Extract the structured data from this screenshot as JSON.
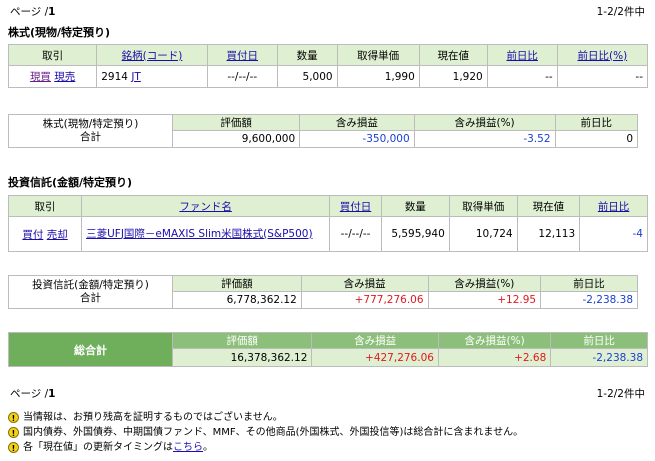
{
  "pager_top": {
    "label": "ページ /",
    "page": "1",
    "count": "1-2/2件中"
  },
  "stocks": {
    "title": "株式(現物/特定預り)",
    "headers": [
      "取引",
      "銘柄(コード)",
      "買付日",
      "数量",
      "取得単価",
      "現在値",
      "前日比",
      "前日比(%)"
    ],
    "row": {
      "buy": "現買",
      "sell": "現売",
      "code": "2914",
      "name": "JT",
      "date": "--/--/--",
      "qty": "5,000",
      "cost": "1,990",
      "price": "1,920",
      "chg": "--",
      "chg_pct": "--"
    }
  },
  "stocks_summary": {
    "label1": "株式(現物/特定預り)",
    "label2": "合計",
    "headers": [
      "評価額",
      "含み損益",
      "含み損益(%)",
      "前日比"
    ],
    "values": [
      "9,600,000",
      "-350,000",
      "-3.52",
      "0"
    ]
  },
  "funds": {
    "title": "投資信託(金額/特定預り)",
    "headers": [
      "取引",
      "ファンド名",
      "買付日",
      "数量",
      "取得単価",
      "現在値",
      "前日比"
    ],
    "row": {
      "buy": "買付",
      "sell": "売却",
      "name": "三菱UFJ国際－eMAXIS Slim米国株式(S&P500)",
      "date": "--/--/--",
      "qty": "5,595,940",
      "cost": "10,724",
      "price": "12,113",
      "chg": "-4"
    }
  },
  "funds_summary": {
    "label1": "投資信託(金額/特定預り)",
    "label2": "合計",
    "headers": [
      "評価額",
      "含み損益",
      "含み損益(%)",
      "前日比"
    ],
    "values": [
      "6,778,362.12",
      "+777,276.06",
      "+12.95",
      "-2,238.38"
    ]
  },
  "grand_total": {
    "label": "総合計",
    "headers": [
      "評価額",
      "含み損益",
      "含み損益(%)",
      "前日比"
    ],
    "values": [
      "16,378,362.12",
      "+427,276.06",
      "+2.68",
      "-2,238.38"
    ]
  },
  "pager_bottom": {
    "label": "ページ /",
    "page": "1",
    "count": "1-2/2件中"
  },
  "notes": [
    {
      "text": "当情報は、お預り残高を証明するものではございません。"
    },
    {
      "text": "国内債券、外国債券、中期国債ファンド、MMF、その他商品(外国株式、外国投信等)は総合計に含まれません。"
    },
    {
      "text": "各「現在値」の更新タイミングは",
      "link": "こちら",
      "suffix": "。"
    }
  ],
  "colors": {
    "header_bg": "#dff0d2",
    "total_bg": "#6fae5b",
    "negative": "#1a3fd0",
    "positive": "#e0191e"
  }
}
